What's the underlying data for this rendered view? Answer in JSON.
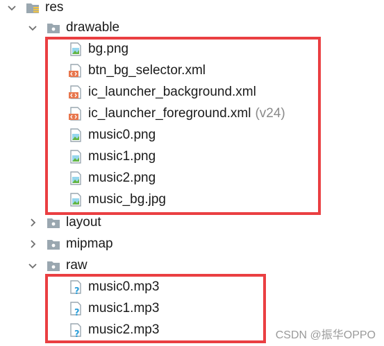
{
  "tree": {
    "res": {
      "label": "res",
      "icon": "folder-resources-icon",
      "expanded": true
    },
    "drawable": {
      "label": "drawable",
      "icon": "folder-icon",
      "expanded": true,
      "files": [
        {
          "label": "bg.png",
          "icon": "image-file-icon"
        },
        {
          "label": "btn_bg_selector.xml",
          "icon": "xml-file-icon"
        },
        {
          "label": "ic_launcher_background.xml",
          "icon": "xml-file-icon"
        },
        {
          "label": "ic_launcher_foreground.xml",
          "suffix": "(v24)",
          "icon": "xml-file-icon"
        },
        {
          "label": "music0.png",
          "icon": "image-file-icon"
        },
        {
          "label": "music1.png",
          "icon": "image-file-icon"
        },
        {
          "label": "music2.png",
          "icon": "image-file-icon"
        },
        {
          "label": "music_bg.jpg",
          "icon": "image-file-icon"
        }
      ]
    },
    "layout": {
      "label": "layout",
      "icon": "folder-icon",
      "expanded": false
    },
    "mipmap": {
      "label": "mipmap",
      "icon": "folder-icon",
      "expanded": false
    },
    "raw": {
      "label": "raw",
      "icon": "folder-icon",
      "expanded": true,
      "files": [
        {
          "label": "music0.mp3",
          "icon": "unknown-file-icon"
        },
        {
          "label": "music1.mp3",
          "icon": "unknown-file-icon"
        },
        {
          "label": "music2.mp3",
          "icon": "unknown-file-icon"
        }
      ]
    }
  },
  "watermark": "CSDN @振华OPPO",
  "colors": {
    "highlight_border": "#ea3f42",
    "text": "#1a1a1a",
    "suffix_text": "#8a8a8a",
    "folder": "#9aa7b0",
    "xml_badge": "#e8774e",
    "image_icon_accent": "#40b6e0",
    "unknown_badge": "#2d9fd9"
  }
}
